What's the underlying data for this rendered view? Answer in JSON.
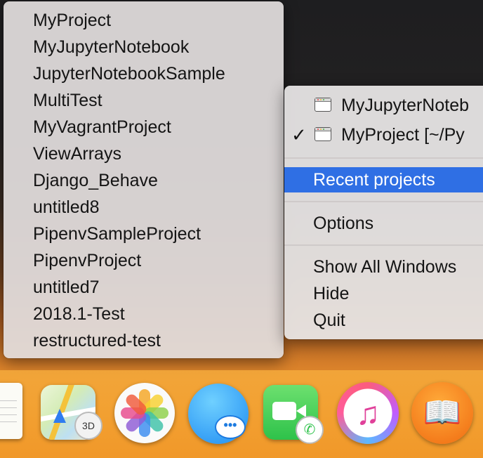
{
  "recent_projects_submenu": {
    "items": [
      "MyProject",
      "MyJupyterNotebook",
      "JupyterNotebookSample",
      "MultiTest",
      "MyVagrantProject",
      "ViewArrays",
      "Django_Behave",
      "untitled8",
      "PipenvSampleProject",
      "PipenvProject",
      "untitled7",
      "2018.1-Test",
      "restructured-test"
    ]
  },
  "dock_menu": {
    "windows": [
      {
        "label": "MyJupyterNoteb",
        "checked": false
      },
      {
        "label": "MyProject [~/Py",
        "checked": true
      }
    ],
    "checkmark": "✓",
    "recent_projects_label": "Recent projects",
    "options_label": "Options",
    "show_all_windows_label": "Show All Windows",
    "hide_label": "Hide",
    "quit_label": "Quit",
    "highlight_color": "#2f6fe4"
  },
  "dock": {
    "compass_label": "3D",
    "messages_glyph": "•••",
    "music_glyph": "♫",
    "books_glyph": "📖",
    "phone_glyph": "✆"
  }
}
